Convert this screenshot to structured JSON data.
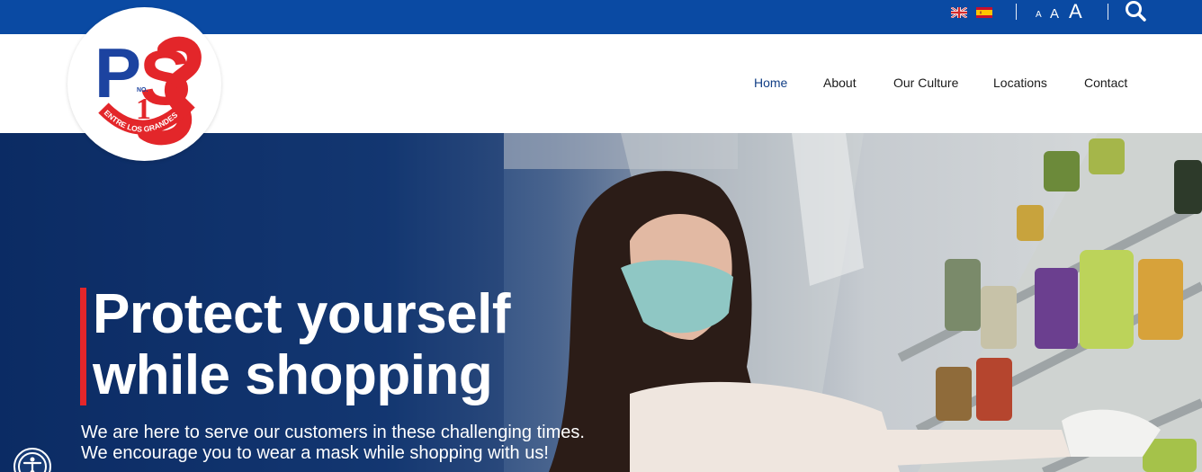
{
  "topbar": {
    "languages": [
      {
        "name": "English",
        "icon": "uk-flag-icon"
      },
      {
        "name": "Spanish",
        "icon": "spain-flag-icon"
      }
    ],
    "font_size": {
      "small": "A",
      "medium": "A",
      "large": "A"
    },
    "search_icon": "search-icon",
    "colors": {
      "bar": "#0a4aa3"
    }
  },
  "logo": {
    "letters": "PS",
    "number_prefix": "NO.",
    "number": "1",
    "ring_text": "ENTRE LOS GRANDES",
    "colors": {
      "blue": "#1c43a0",
      "red": "#e3262a"
    }
  },
  "nav": {
    "items": [
      {
        "label": "Home",
        "active": true
      },
      {
        "label": "About",
        "active": false
      },
      {
        "label": "Our Culture",
        "active": false
      },
      {
        "label": "Locations",
        "active": false
      },
      {
        "label": "Contact",
        "active": false
      }
    ],
    "colors": {
      "active": "#123f86",
      "default": "#1a1a1a"
    }
  },
  "hero": {
    "title_line1": "Protect yourself",
    "title_line2": "while shopping",
    "subtitle_line1": "We are here to serve our customers in these challenging times.",
    "subtitle_line2": "We encourage you to wear a mask while shopping with us!",
    "colors": {
      "accent": "#e3262a",
      "overlay": "#0c2c64"
    }
  },
  "accessibility": {
    "icon": "accessibility-icon"
  }
}
